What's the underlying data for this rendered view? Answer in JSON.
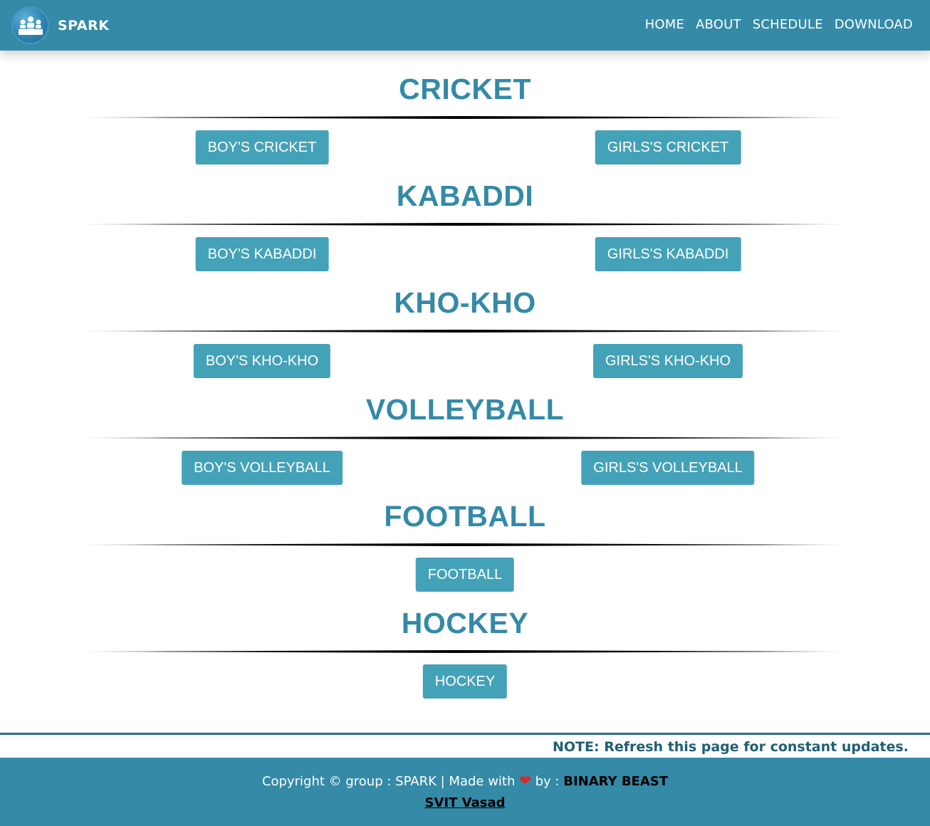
{
  "header": {
    "brand": "SPARK",
    "logo_icon": "podium-icon",
    "nav": [
      "HOME",
      "ABOUT",
      "SCHEDULE",
      "DOWNLOAD"
    ]
  },
  "sections": [
    {
      "title": "CRICKET",
      "buttons": [
        "BOY'S CRICKET",
        "GIRLS'S CRICKET"
      ]
    },
    {
      "title": "KABADDI",
      "buttons": [
        "BOY'S KABADDI",
        "GIRLS'S KABADDI"
      ]
    },
    {
      "title": "KHO-KHO",
      "buttons": [
        "BOY'S KHO-KHO",
        "GIRLS'S KHO-KHO"
      ]
    },
    {
      "title": "VOLLEYBALL",
      "buttons": [
        "BOY'S VOLLEYBALL",
        "GIRLS'S VOLLEYBALL"
      ]
    },
    {
      "title": "FOOTBALL",
      "buttons": [
        "FOOTBALL"
      ]
    },
    {
      "title": "HOCKEY",
      "buttons": [
        "HOCKEY"
      ]
    }
  ],
  "note": "NOTE: Refresh this page for constant updates.",
  "footer": {
    "copyright": "Copyright © group : SPARK | Made with",
    "heart": "❤",
    "by": "by :",
    "team": "BINARY BEAST",
    "college": "SVIT Vasad"
  },
  "colors": {
    "primary": "#348aa7",
    "button": "#44a2b8",
    "heading": "#348aa7",
    "heart": "#e0262b"
  }
}
